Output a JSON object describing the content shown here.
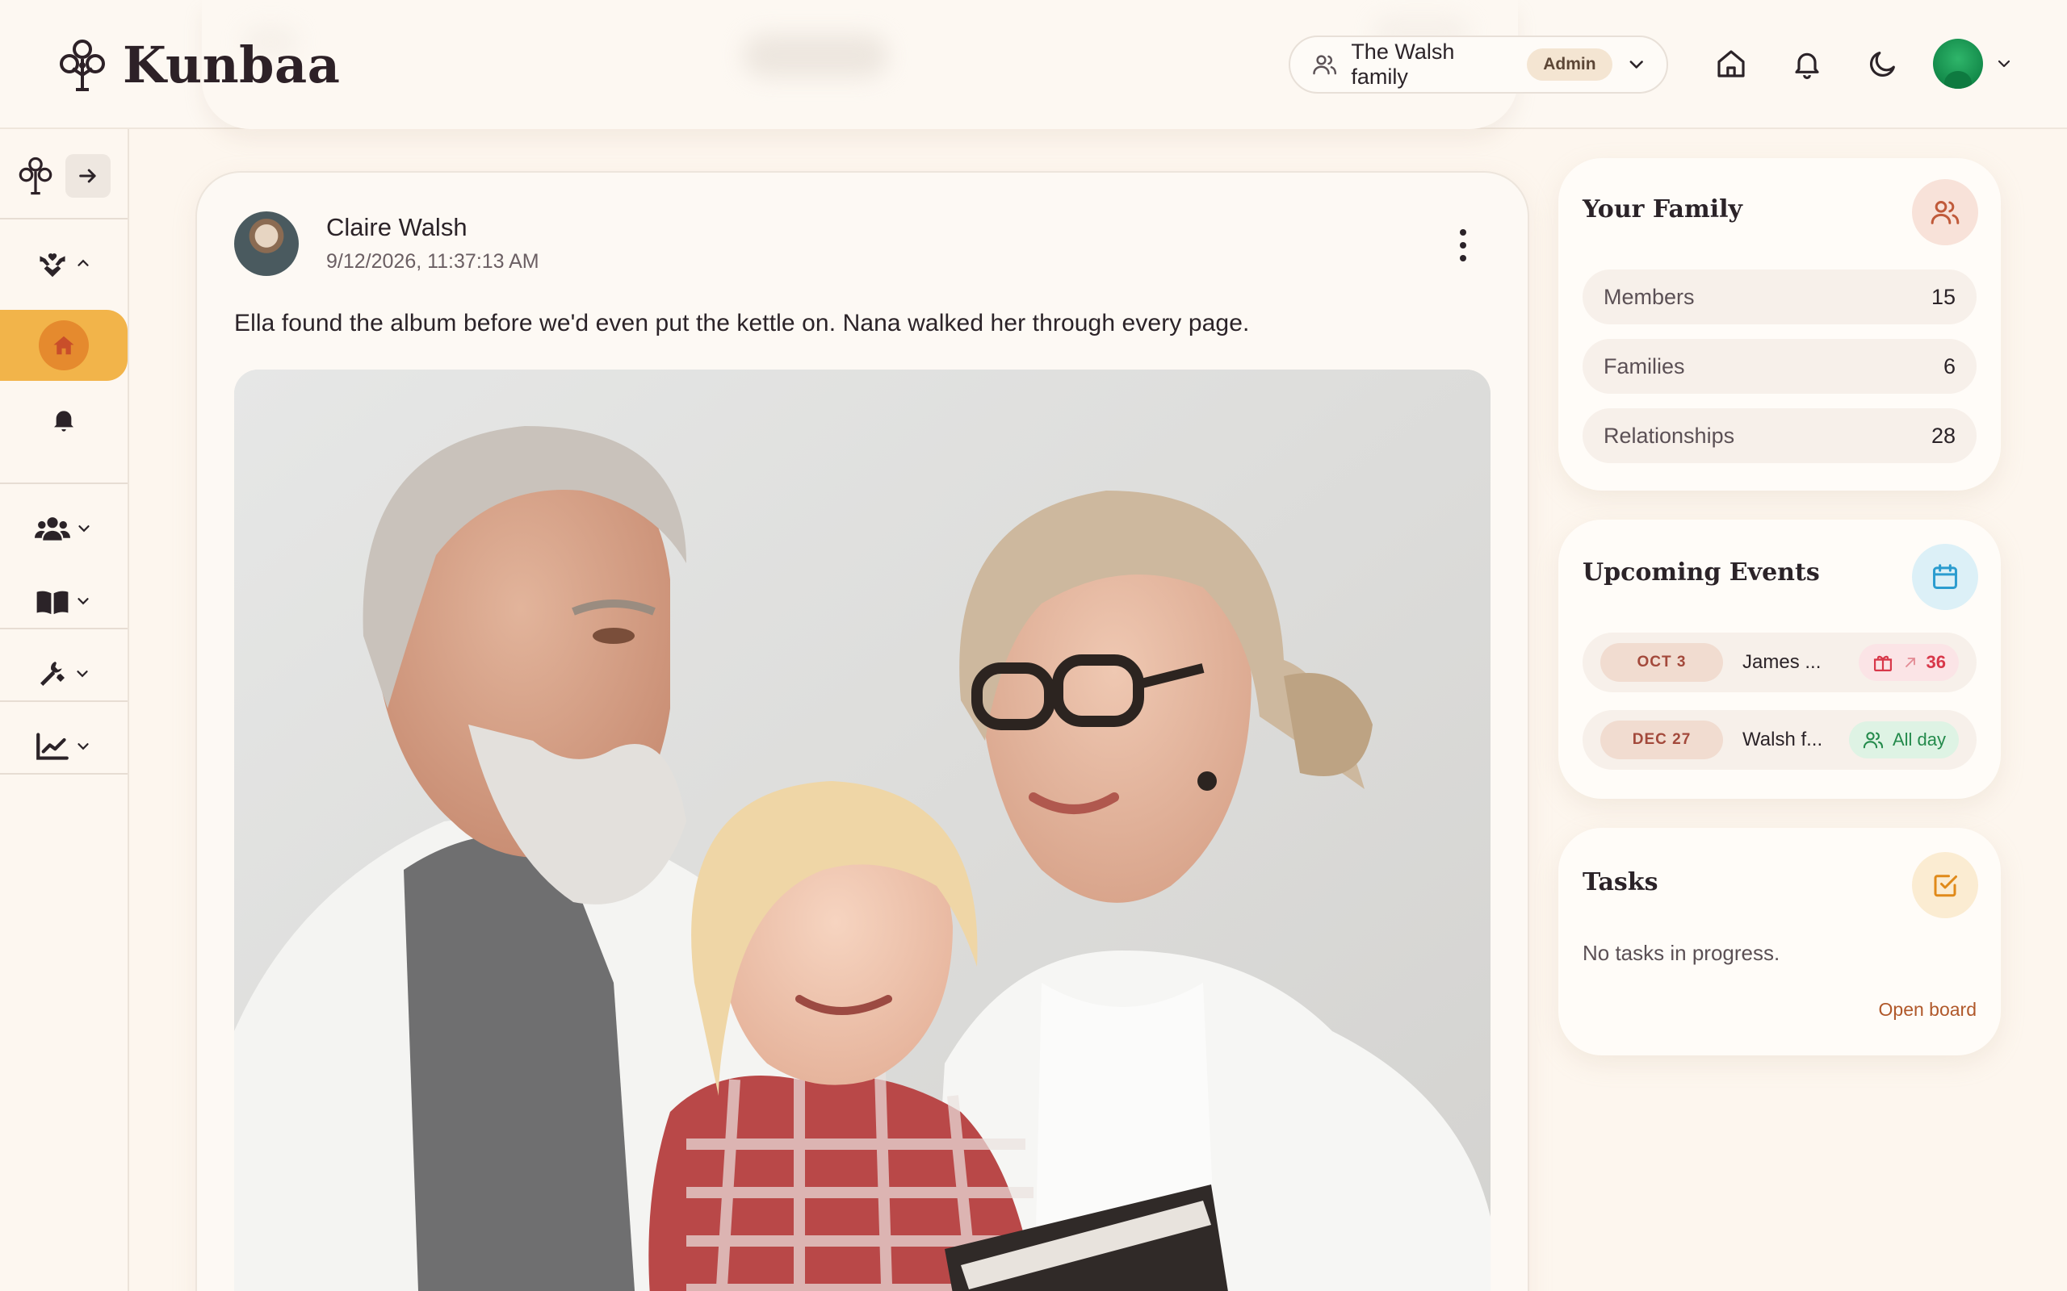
{
  "app": {
    "name": "Kunbaa"
  },
  "header": {
    "family_name": "The Walsh family",
    "role_badge": "Admin",
    "icons": [
      "home-icon",
      "bell-icon",
      "moon-icon",
      "avatar"
    ]
  },
  "sidebar": {
    "items": [
      {
        "icon": "family-tree-icon",
        "expandable": true
      },
      {
        "icon": "home-icon",
        "active": true
      },
      {
        "icon": "bell-icon"
      },
      {
        "icon": "users-icon",
        "expandable": true
      },
      {
        "icon": "book-icon",
        "expandable": true
      },
      {
        "icon": "tools-icon",
        "expandable": true
      },
      {
        "icon": "chart-icon",
        "expandable": true
      }
    ]
  },
  "post": {
    "author": "Claire Walsh",
    "timestamp": "9/12/2026, 11:37:13 AM",
    "text": "Ella found the album before we'd even put the kettle on. Nana walked her through every page."
  },
  "your_family": {
    "title": "Your Family",
    "stats": [
      {
        "label": "Members",
        "value": "15"
      },
      {
        "label": "Families",
        "value": "6"
      },
      {
        "label": "Relationships",
        "value": "28"
      }
    ]
  },
  "upcoming_events": {
    "title": "Upcoming Events",
    "events": [
      {
        "date": "OCT 3",
        "name": "James ...",
        "tag": "36",
        "tag_type": "birthday"
      },
      {
        "date": "DEC 27",
        "name": "Walsh f...",
        "tag": "All day",
        "tag_type": "family"
      }
    ]
  },
  "tasks": {
    "title": "Tasks",
    "empty_text": "No tasks in progress.",
    "link": "Open board"
  },
  "colors": {
    "background": "#fdf6ee",
    "accent_amber": "#f2b44a",
    "accent_orange": "#e58a2e",
    "birthday_red": "#d8384a",
    "success_green": "#238a4b",
    "link_brown": "#b0582a"
  }
}
